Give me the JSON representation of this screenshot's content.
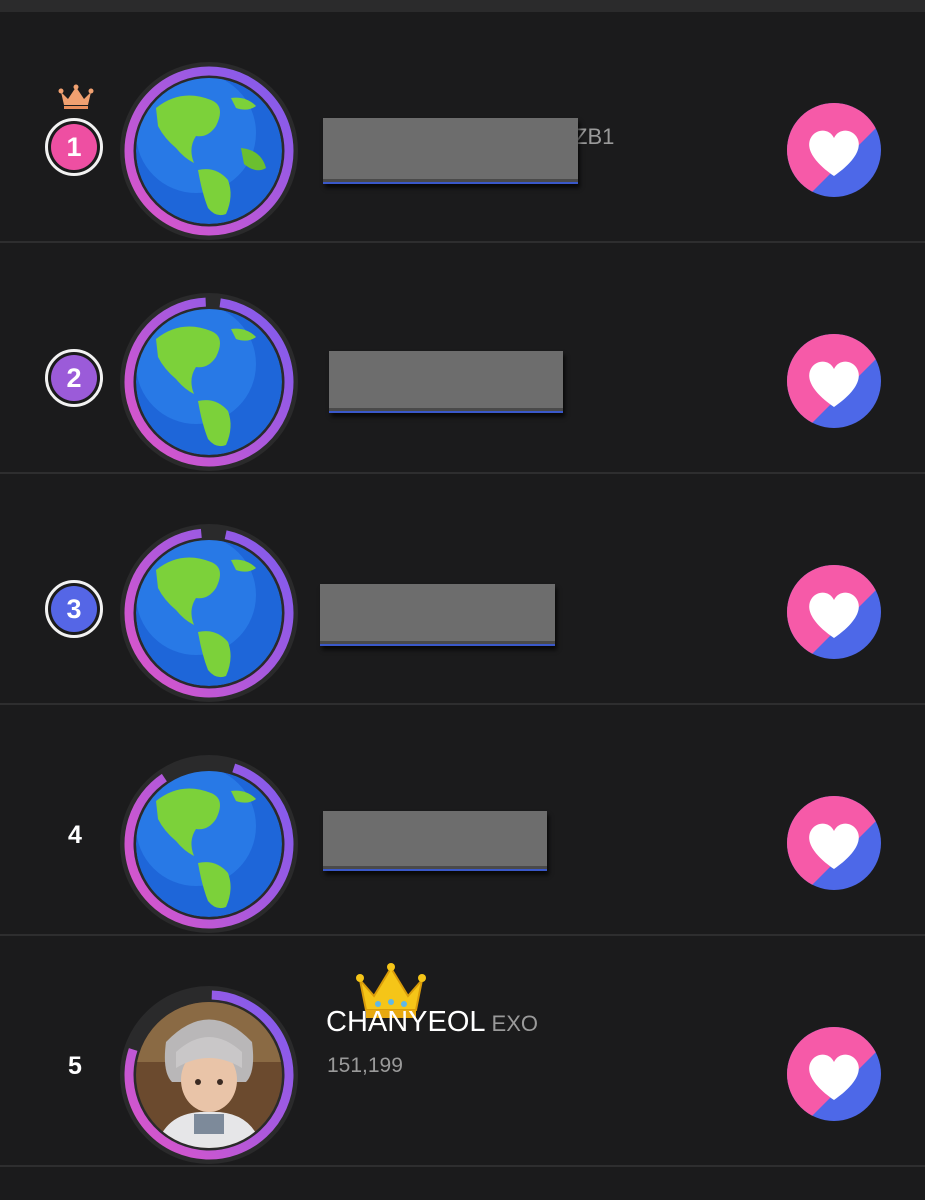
{
  "colors": {
    "background": "#1b1b1c",
    "rank1": "#ee4fa2",
    "rank2": "#9b5bd9",
    "rank3": "#5566e6",
    "heart_pink": "#f65aa8",
    "heart_blue": "#4d68e8"
  },
  "rows": [
    {
      "rank": "1",
      "style": "badge",
      "badge_color": "#ee4fa2",
      "crown": "small",
      "avatar": "globe-icon",
      "name": "",
      "group": "ZB1",
      "votes": "",
      "redacted": true,
      "action_icon": "heart-icon"
    },
    {
      "rank": "2",
      "style": "badge",
      "badge_color": "#9b5bd9",
      "crown": "none",
      "avatar": "globe-icon",
      "name": "",
      "group": "",
      "votes": "",
      "redacted": true,
      "action_icon": "heart-icon"
    },
    {
      "rank": "3",
      "style": "badge",
      "badge_color": "#5566e6",
      "crown": "none",
      "avatar": "globe-icon",
      "name": "",
      "group": "",
      "votes": "",
      "redacted": true,
      "action_icon": "heart-icon"
    },
    {
      "rank": "4",
      "style": "plain",
      "crown": "none",
      "avatar": "globe-icon",
      "name": "",
      "group": "",
      "votes": "",
      "redacted": true,
      "action_icon": "heart-icon"
    },
    {
      "rank": "5",
      "style": "plain",
      "crown": "big",
      "avatar": "profile-photo",
      "name": "CHANYEOL",
      "group": "EXO",
      "votes": "151,199",
      "redacted": false,
      "action_icon": "heart-icon"
    }
  ]
}
